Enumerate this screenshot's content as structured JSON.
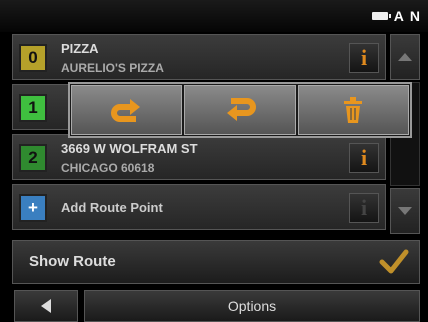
{
  "status_bar": {
    "icons": [
      "battery-icon",
      "signal-a-icon",
      "gps-icon"
    ],
    "signal_glyph": "A",
    "gps_glyph": "N"
  },
  "route_points": [
    {
      "badge": "0",
      "title": "PIZZA",
      "subtitle": "AURELIO'S PIZZA"
    },
    {
      "badge": "1",
      "title": "",
      "subtitle": ""
    },
    {
      "badge": "2",
      "title": "3669 W WOLFRAM ST",
      "subtitle": "CHICAGO 60618"
    },
    {
      "badge": "+",
      "title": "Add Route Point",
      "subtitle": ""
    }
  ],
  "info_glyph": "i",
  "popup": {
    "actions": [
      "move-up-icon",
      "move-down-icon",
      "delete-icon"
    ]
  },
  "show_route": {
    "label": "Show Route"
  },
  "footer": {
    "options_label": "Options"
  },
  "colors": {
    "accent_orange": "#e8961e",
    "badge_0": "#b5a12a",
    "badge_1": "#3fbf3f",
    "badge_2": "#2f8a2f",
    "badge_add": "#3a7fc0"
  }
}
